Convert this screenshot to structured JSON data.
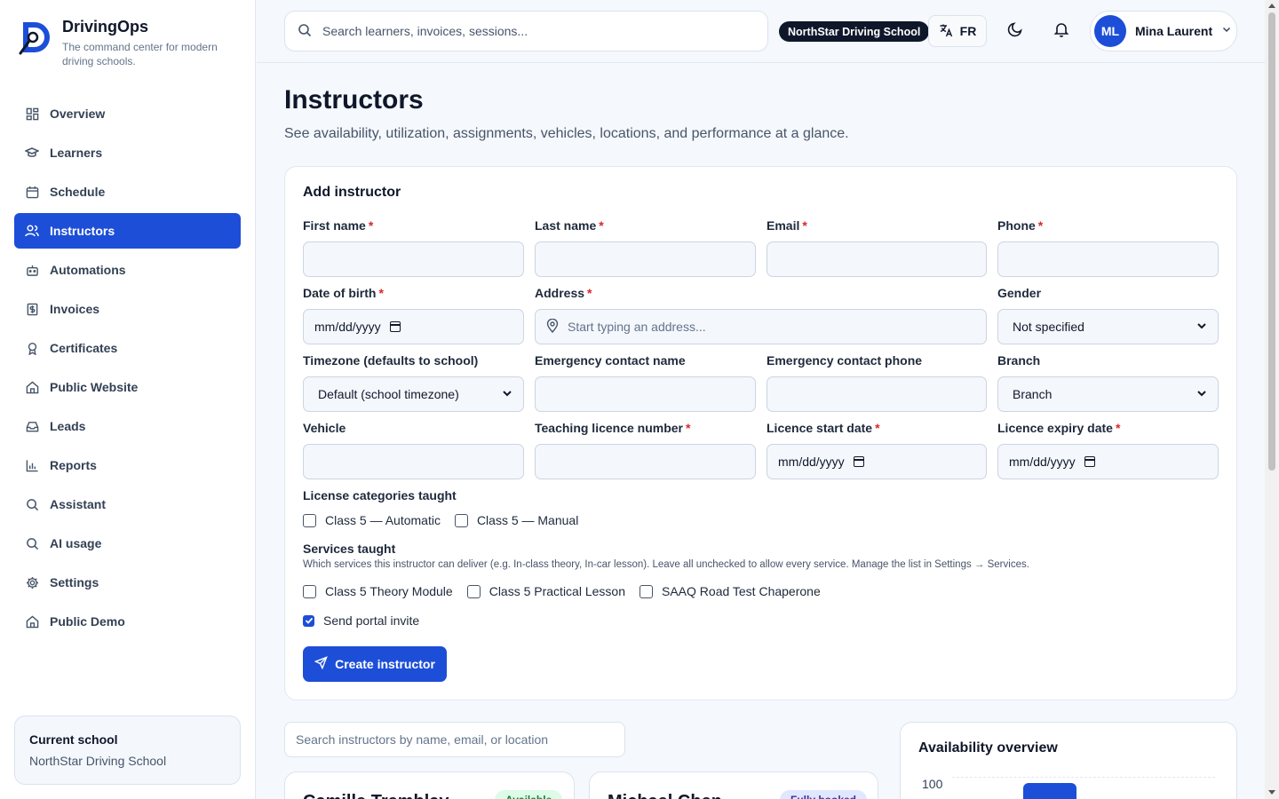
{
  "brand": {
    "name": "DrivingOps",
    "tagline": "The command center for modern driving schools."
  },
  "sidebar": {
    "items": [
      {
        "label": "Overview",
        "icon": "grid-icon",
        "active": false
      },
      {
        "label": "Learners",
        "icon": "graduation-cap-icon",
        "active": false
      },
      {
        "label": "Schedule",
        "icon": "calendar-icon",
        "active": false
      },
      {
        "label": "Instructors",
        "icon": "users-icon",
        "active": true
      },
      {
        "label": "Automations",
        "icon": "bot-icon",
        "active": false
      },
      {
        "label": "Invoices",
        "icon": "dollar-receipt-icon",
        "active": false
      },
      {
        "label": "Certificates",
        "icon": "award-icon",
        "active": false
      },
      {
        "label": "Public Website",
        "icon": "home-icon",
        "active": false
      },
      {
        "label": "Leads",
        "icon": "inbox-icon",
        "active": false
      },
      {
        "label": "Reports",
        "icon": "bar-chart-icon",
        "active": false
      },
      {
        "label": "Assistant",
        "icon": "search-icon",
        "active": false
      },
      {
        "label": "AI usage",
        "icon": "search-icon",
        "active": false
      },
      {
        "label": "Settings",
        "icon": "gear-icon",
        "active": false
      },
      {
        "label": "Public Demo",
        "icon": "home-icon",
        "active": false
      }
    ],
    "current_school_title": "Current school",
    "current_school_value": "NorthStar Driving School"
  },
  "topbar": {
    "search_placeholder": "Search learners, invoices, sessions...",
    "school_pill": "NorthStar Driving School",
    "language": "FR",
    "user_initials": "ML",
    "user_name": "Mina Laurent"
  },
  "page": {
    "title": "Instructors",
    "subtitle": "See availability, utilization, assignments, vehicles, locations, and performance at a glance."
  },
  "form": {
    "title": "Add instructor",
    "first_name": {
      "label": "First name",
      "value": ""
    },
    "last_name": {
      "label": "Last name",
      "value": ""
    },
    "email": {
      "label": "Email",
      "value": ""
    },
    "phone": {
      "label": "Phone",
      "value": ""
    },
    "dob": {
      "label": "Date of birth",
      "value": "mm/dd/yyyy"
    },
    "address": {
      "label": "Address",
      "placeholder": "Start typing an address..."
    },
    "gender": {
      "label": "Gender",
      "value": "Not specified"
    },
    "timezone": {
      "label": "Timezone (defaults to school)",
      "value": "Default (school timezone)"
    },
    "emergency_name": {
      "label": "Emergency contact name",
      "value": ""
    },
    "emergency_phone": {
      "label": "Emergency contact phone",
      "value": ""
    },
    "branch": {
      "label": "Branch",
      "value": "Branch"
    },
    "vehicle": {
      "label": "Vehicle",
      "value": ""
    },
    "licence_number": {
      "label": "Teaching licence number",
      "value": ""
    },
    "licence_start": {
      "label": "Licence start date",
      "value": "mm/dd/yyyy"
    },
    "licence_expiry": {
      "label": "Licence expiry date",
      "value": "mm/dd/yyyy"
    },
    "categories_label": "License categories taught",
    "categories": [
      {
        "label": "Class 5 — Automatic",
        "checked": false
      },
      {
        "label": "Class 5 — Manual",
        "checked": false
      }
    ],
    "services_label": "Services taught",
    "services_help": "Which services this instructor can deliver (e.g. In-class theory, In-car lesson). Leave all unchecked to allow every service. Manage the list in Settings → Services.",
    "services": [
      {
        "label": "Class 5 Theory Module",
        "checked": false
      },
      {
        "label": "Class 5 Practical Lesson",
        "checked": false
      },
      {
        "label": "SAAQ Road Test Chaperone",
        "checked": false
      }
    ],
    "portal_invite": {
      "label": "Send portal invite",
      "checked": true
    },
    "submit_label": "Create instructor"
  },
  "list": {
    "filter_placeholder": "Search instructors by name, email, or location",
    "cards": [
      {
        "name": "Camille Tremblay",
        "badge": "Available",
        "badge_bg": "#dcfce7",
        "badge_fg": "#15803d"
      },
      {
        "name": "Michael Chen",
        "badge": "Fully booked",
        "badge_bg": "#e0e7ff",
        "badge_fg": "#3730a3"
      }
    ]
  },
  "availability": {
    "title": "Availability overview",
    "tick": "100"
  },
  "colors": {
    "accent": "#1d4ed8",
    "required": "#dc2626"
  }
}
